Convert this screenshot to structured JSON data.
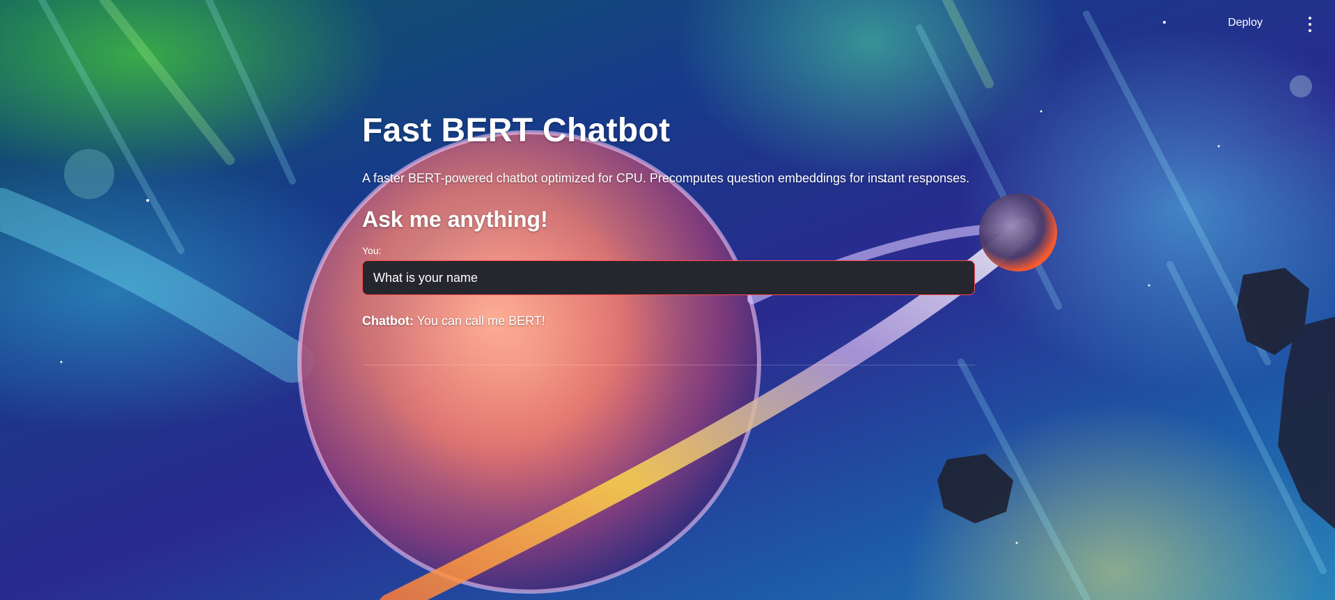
{
  "header": {
    "deploy_label": "Deploy"
  },
  "main": {
    "title": "Fast BERT Chatbot",
    "description": "A faster BERT-powered chatbot optimized for CPU. Precomputes question embeddings for instant responses.",
    "subheader": "Ask me anything!",
    "input": {
      "label": "You:",
      "value": "What is your name"
    },
    "response": {
      "label": "Chatbot:",
      "text": "You can call me BERT!"
    }
  },
  "colors": {
    "input_background": "#26262e",
    "input_border": "#ff4b4b",
    "text": "#ffffff"
  },
  "icons": {
    "menu": "vertical-ellipsis-icon"
  }
}
